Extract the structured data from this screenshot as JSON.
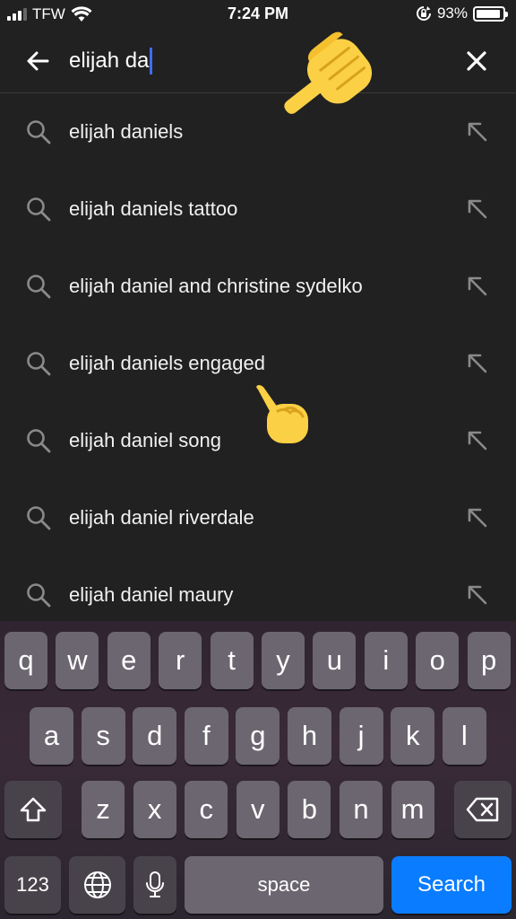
{
  "status_bar": {
    "carrier": "TFW",
    "time": "7:24 PM",
    "battery_percent": "93%",
    "battery_level": 0.93
  },
  "search": {
    "query": "elijah da"
  },
  "suggestions": [
    {
      "text": "elijah daniels"
    },
    {
      "text": "elijah daniels tattoo"
    },
    {
      "text": "elijah daniel and christine sydelko"
    },
    {
      "text": "elijah daniels engaged"
    },
    {
      "text": "elijah daniel song"
    },
    {
      "text": "elijah daniel riverdale"
    },
    {
      "text": "elijah daniel maury"
    }
  ],
  "icons": {
    "back": "arrow-left-icon",
    "clear": "close-icon",
    "suggestion": "search-icon",
    "fill": "arrow-up-left-icon",
    "overlay": "pointing-hand-emoji"
  },
  "keyboard": {
    "row1": [
      "q",
      "w",
      "e",
      "r",
      "t",
      "y",
      "u",
      "i",
      "o",
      "p"
    ],
    "row2": [
      "a",
      "s",
      "d",
      "f",
      "g",
      "h",
      "j",
      "k",
      "l"
    ],
    "row3": [
      "z",
      "x",
      "c",
      "v",
      "b",
      "n",
      "m"
    ],
    "numbers_label": "123",
    "space_label": "space",
    "search_label": "Search"
  },
  "colors": {
    "background": "#212121",
    "caret": "#3b6df0",
    "search_key": "#0a7cff",
    "key": "#6b6670"
  }
}
